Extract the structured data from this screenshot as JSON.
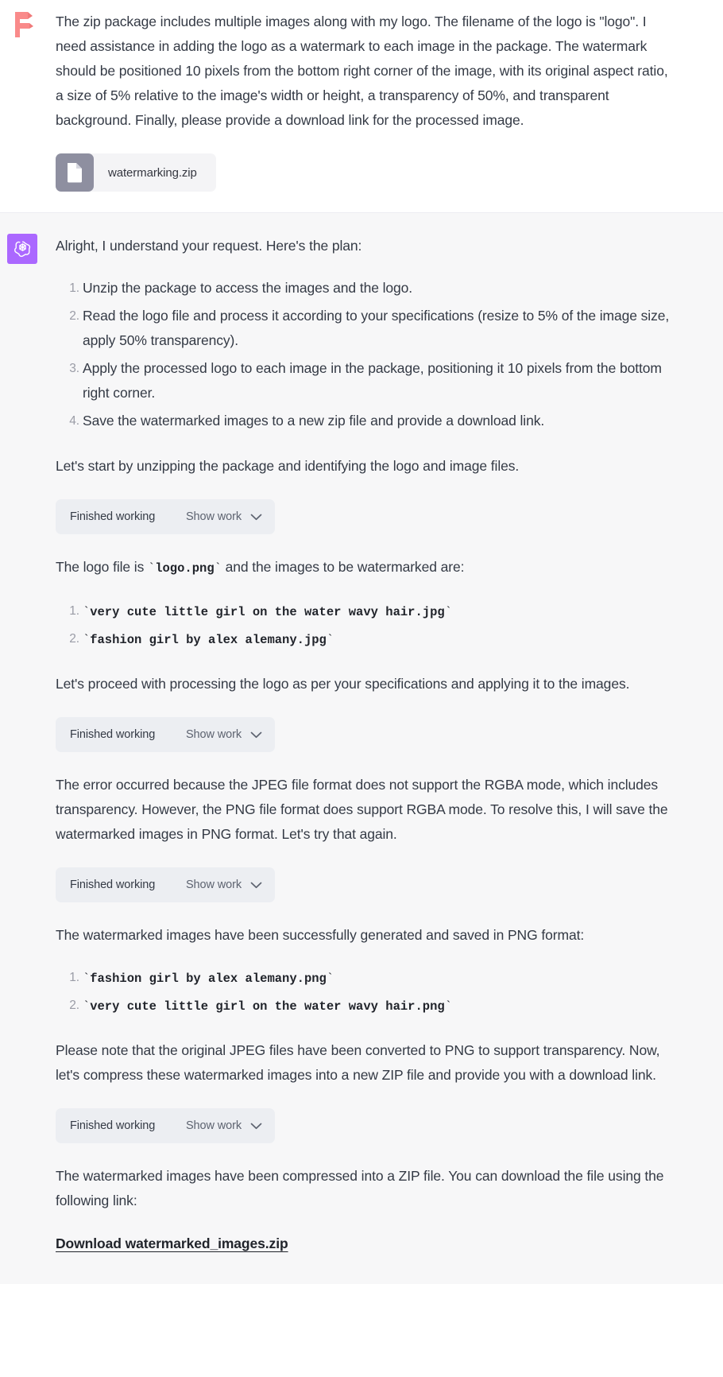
{
  "colors": {
    "assistant_avatar_bg": "#ab68ff",
    "user_avatar_fill": "#f98a8a",
    "assistant_block_bg": "#f7f7f8",
    "user_block_bg": "#ffffff",
    "body_text": "#343a45",
    "muted_text": "#5d6370",
    "list_number": "#9a9ca6",
    "widget_bg": "#eceef2",
    "file_icon_bg": "#8e8fa0",
    "link_text": "#21242b"
  },
  "user_message": {
    "avatar_icon": "figma-f-logo-icon",
    "paragraph": "The zip package includes multiple images along with my logo. The filename of the logo is \"logo\". I need assistance in adding the logo as a watermark to each image in the package. The watermark should be positioned 10 pixels from the bottom right corner of the image, with its original aspect ratio, a size of 5% relative to the image's width or height, a transparency of 50%, and transparent background. Finally, please provide a download link for the processed image.",
    "attachment": {
      "icon": "document-file-icon",
      "filename": "watermarking.zip"
    }
  },
  "assistant_message": {
    "avatar_icon": "openai-logo-icon",
    "intro": "Alright, I understand your request. Here's the plan:",
    "plan_steps": [
      "Unzip the package to access the images and the logo.",
      "Read the logo file and process it according to your specifications (resize to 5% of the image size, apply 50% transparency).",
      "Apply the processed logo to each image in the package, positioning it 10 pixels from the bottom right corner.",
      "Save the watermarked images to a new zip file and provide a download link."
    ],
    "para_start": "Let's start by unzipping the package and identifying the logo and image files.",
    "work_widget_1": {
      "status": "Finished working",
      "action": "Show work",
      "chevron": "chevron-down-icon"
    },
    "logo_line": {
      "prefix": "The logo file is ",
      "code": "logo.png",
      "suffix": " and the images to be watermarked are:"
    },
    "image_files": [
      "very cute little girl on the water wavy hair.jpg",
      "fashion girl by alex alemany.jpg"
    ],
    "para_proceed": "Let's proceed with processing the logo as per your specifications and applying it to the images.",
    "work_widget_2": {
      "status": "Finished working",
      "action": "Show work",
      "chevron": "chevron-down-icon"
    },
    "para_error": "The error occurred because the JPEG file format does not support the RGBA mode, which includes transparency. However, the PNG file format does support RGBA mode. To resolve this, I will save the watermarked images in PNG format. Let's try that again.",
    "work_widget_3": {
      "status": "Finished working",
      "action": "Show work",
      "chevron": "chevron-down-icon"
    },
    "para_success": "The watermarked images have been successfully generated and saved in PNG format:",
    "output_files": [
      "fashion girl by alex alemany.png",
      "very cute little girl on the water wavy hair.png"
    ],
    "para_note": "Please note that the original JPEG files have been converted to PNG to support transparency. Now, let's compress these watermarked images into a new ZIP file and provide you with a download link.",
    "work_widget_4": {
      "status": "Finished working",
      "action": "Show work",
      "chevron": "chevron-down-icon"
    },
    "para_final": "The watermarked images have been compressed into a ZIP file. You can download the file using the following link:",
    "download_link": "Download watermarked_images.zip"
  }
}
